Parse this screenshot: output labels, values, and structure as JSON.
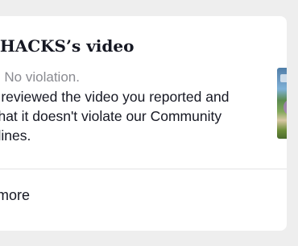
{
  "card": {
    "title": "T HACKS’s video",
    "status": "us: No violation.",
    "message": "ve reviewed the video you reported and\nd that it doesn't violate our Community\ndelines.",
    "thumbnail_icon": "video-thumbnail",
    "view_more_label": "w more"
  },
  "colors": {
    "background": "#eeeeee",
    "card": "#ffffff",
    "text_primary": "#161823",
    "text_secondary": "#8a8b91",
    "divider": "#e3e3e4"
  }
}
